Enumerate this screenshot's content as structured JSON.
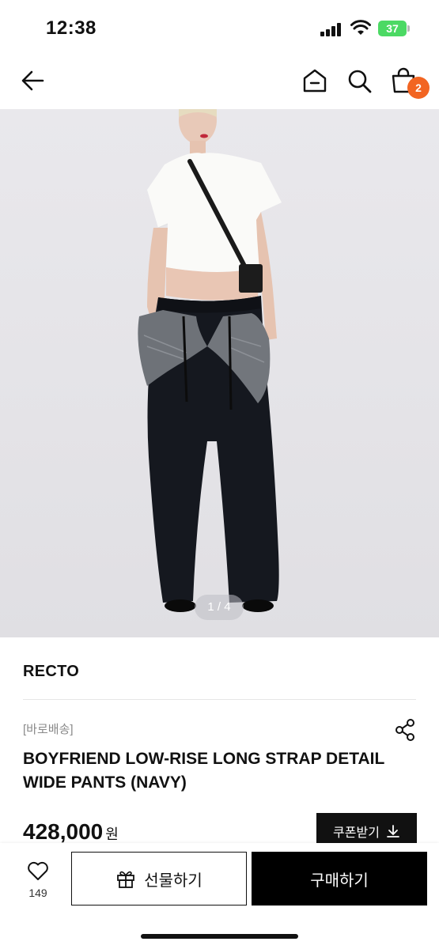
{
  "status_bar": {
    "time": "12:38",
    "battery": "37"
  },
  "nav": {
    "cart_count": "2"
  },
  "gallery": {
    "pager": "1 / 4"
  },
  "product": {
    "brand": "RECTO",
    "tag": "[바로배송]",
    "title": "BOYFRIEND LOW-RISE LONG STRAP DETAIL WIDE PANTS (NAVY)",
    "price": "428,000",
    "currency": "원",
    "coupon_label": "쿠폰받기"
  },
  "bottom_bar": {
    "like_count": "149",
    "gift_label": "선물하기",
    "buy_label": "구매하기"
  },
  "colors": {
    "badge": "#f26522",
    "battery": "#4cd964",
    "primary": "#000000"
  },
  "icons": [
    "back-arrow-icon",
    "home-icon",
    "search-icon",
    "shopping-bag-icon",
    "share-icon",
    "download-icon",
    "heart-icon",
    "gift-icon"
  ]
}
